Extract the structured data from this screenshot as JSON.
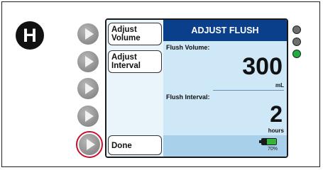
{
  "step_badge": "H",
  "soft_keys": [
    "soft-key-1",
    "soft-key-2",
    "soft-key-3",
    "soft-key-4",
    "soft-key-5"
  ],
  "menu": {
    "adjust_volume": "Adjust Volume",
    "adjust_interval": "Adjust Interval",
    "done": "Done"
  },
  "screen": {
    "title": "ADJUST FLUSH",
    "flush_volume_label": "Flush Volume:",
    "flush_volume_value": "300",
    "flush_volume_unit": "mL",
    "flush_interval_label": "Flush Interval:",
    "flush_interval_value": "2",
    "flush_interval_unit": "hours",
    "battery_percent_text": "70%",
    "battery_level": 0.7
  },
  "indicator_leds": [
    {
      "name": "led-1",
      "color": "#6e6e6e"
    },
    {
      "name": "led-2",
      "color": "#6e6e6e"
    },
    {
      "name": "led-3",
      "color": "#1fae3b"
    }
  ],
  "colors": {
    "header": "#0a3f8c",
    "highlight_ring": "#c8102e",
    "screen_bg": "#cfe8f8",
    "battery_fill": "#35b33a"
  }
}
